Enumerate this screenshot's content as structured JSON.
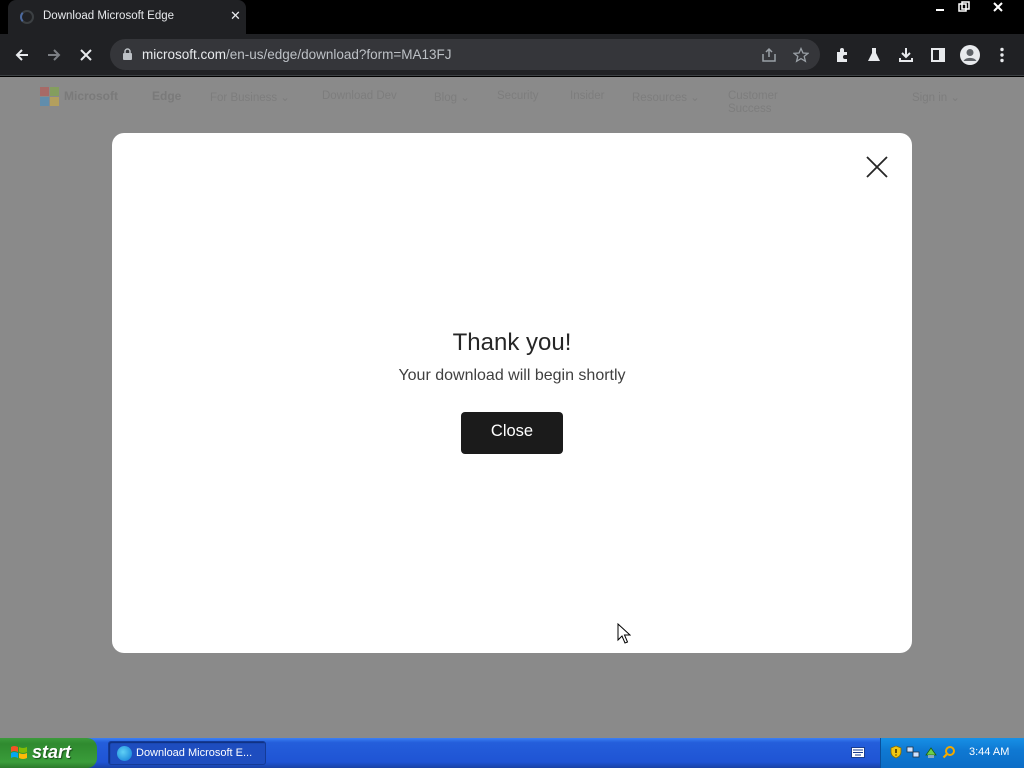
{
  "browser": {
    "tab_title": "Download Microsoft Edge",
    "tab_close": "✕",
    "url_host": "microsoft.com",
    "url_path": "/en-us/edge/download?form=MA13FJ",
    "window_controls": [
      "minimize-icon",
      "restore-icon",
      "close-icon"
    ]
  },
  "site_nav": {
    "logo_text": "Microsoft",
    "brand": "Edge",
    "items": [
      "For Business ⌄",
      "Download Dev",
      "Blog ⌄",
      "Security",
      "Insider",
      "Resources ⌄",
      "Customer Success"
    ],
    "account": "Sign in ⌄"
  },
  "modal": {
    "title": "Thank you!",
    "subtitle": "Your download will begin shortly",
    "button": "Close"
  },
  "taskbar": {
    "start_label": "start",
    "task_label": "Download Microsoft E...",
    "clock": "3:44 AM"
  },
  "colors": {
    "chrome_dark": "#202124",
    "overlay": "#8a8a8a",
    "button_dark": "#1b1b1b",
    "taskbar_blue": "#245edb",
    "start_green": "#3a9d3a"
  }
}
